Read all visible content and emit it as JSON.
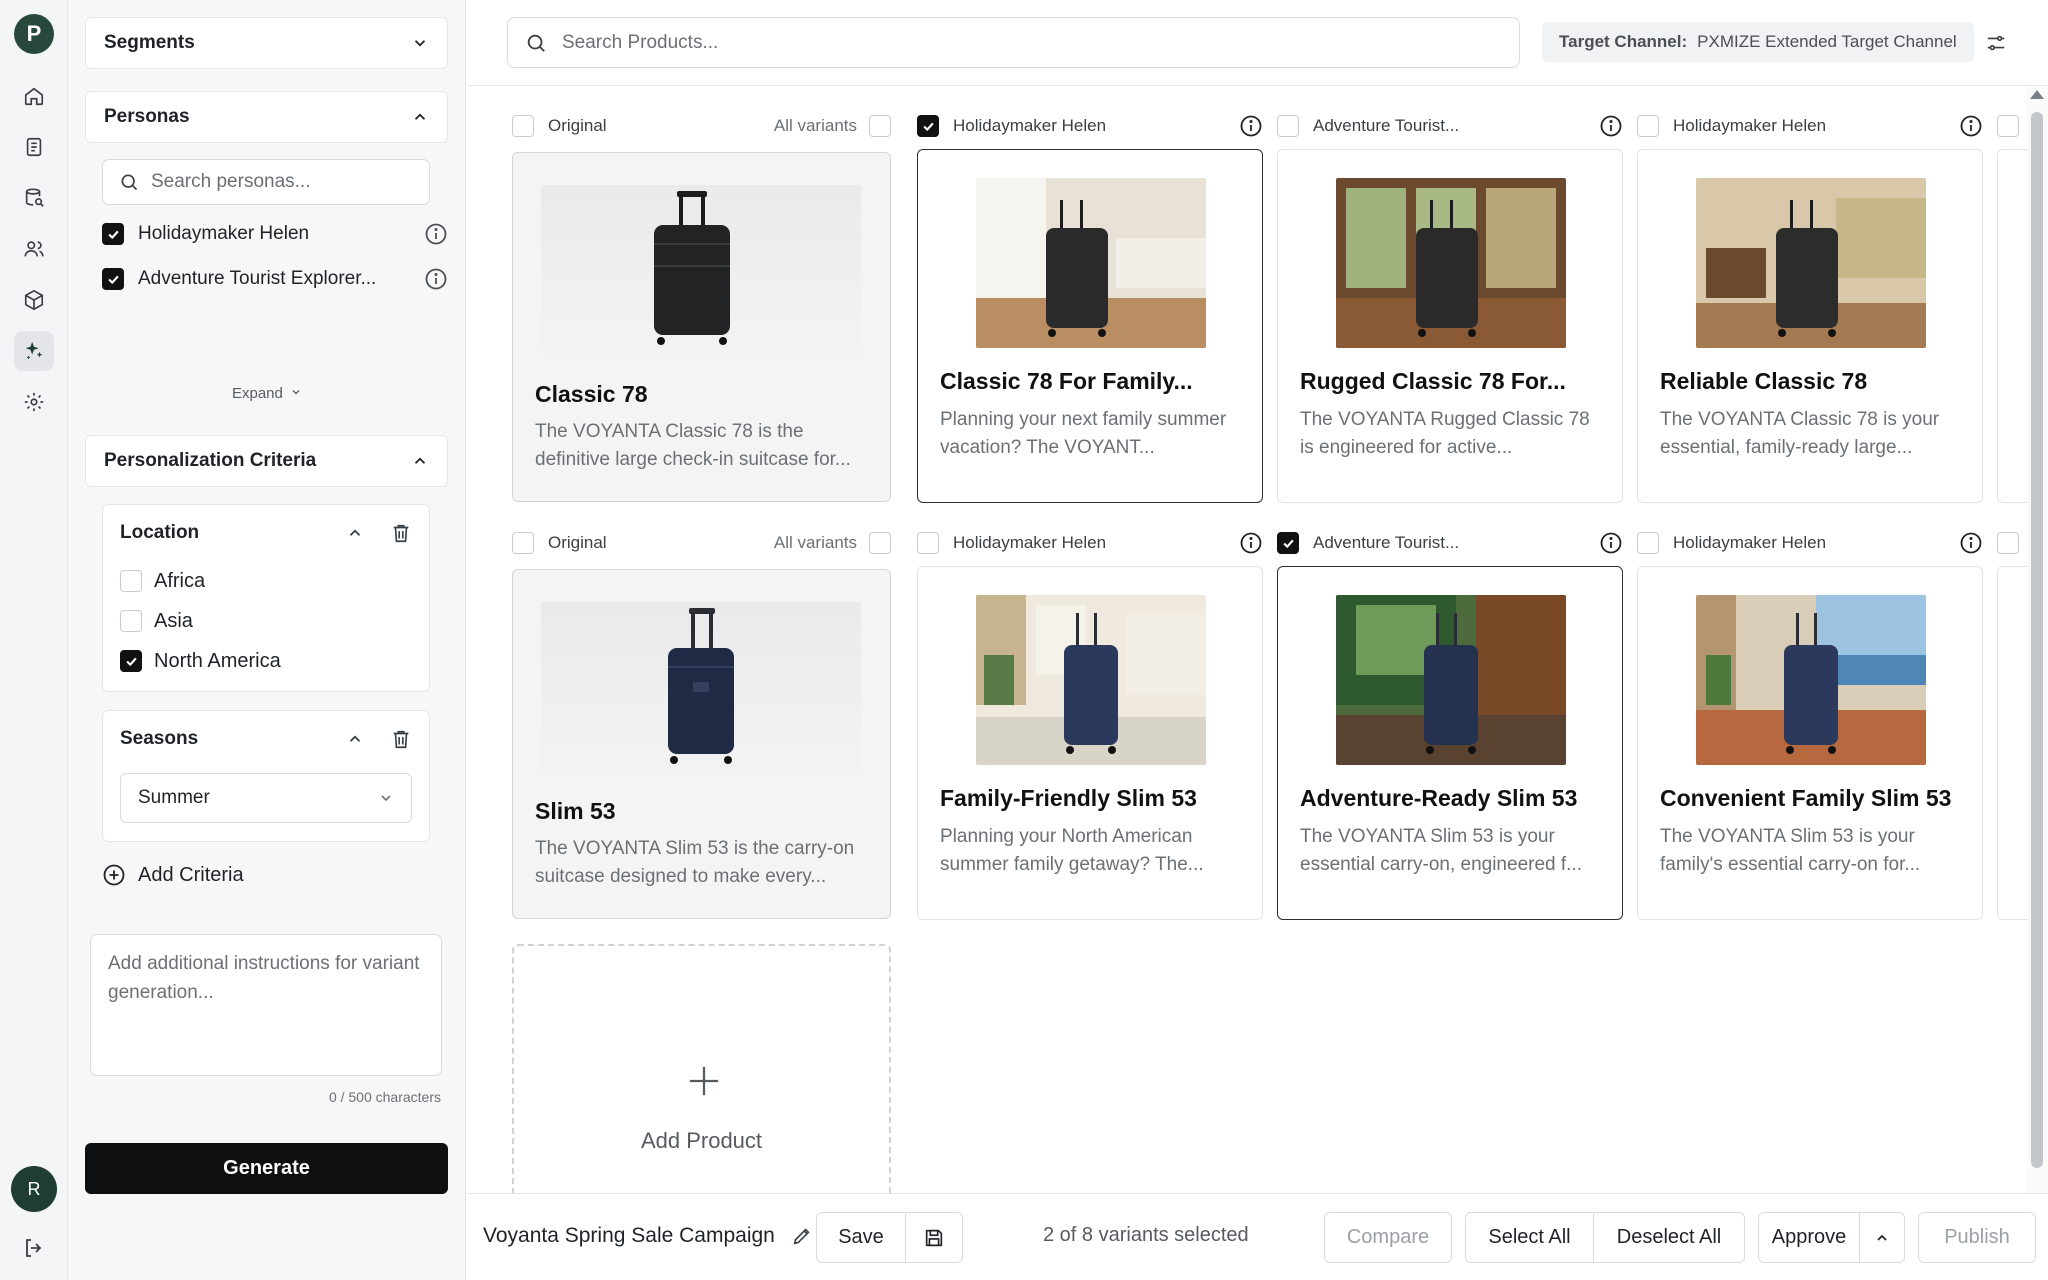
{
  "rail": {
    "logo_letter": "P",
    "avatar_letter": "R",
    "items": [
      "home-icon",
      "document-icon",
      "database-icon",
      "users-icon",
      "box-icon",
      "sparkle-icon",
      "gear-icon"
    ],
    "active_index": 5
  },
  "panel": {
    "segments_label": "Segments",
    "personas_label": "Personas",
    "persona_search_placeholder": "Search personas...",
    "personas": [
      {
        "label": "Holidaymaker Helen",
        "checked": true
      },
      {
        "label": "Adventure Tourist Explorer...",
        "checked": true
      }
    ],
    "expand_label": "Expand",
    "criteria_label": "Personalization Criteria",
    "location": {
      "label": "Location",
      "options": [
        {
          "label": "Africa",
          "checked": false
        },
        {
          "label": "Asia",
          "checked": false
        },
        {
          "label": "North America",
          "checked": true
        }
      ]
    },
    "seasons": {
      "label": "Seasons",
      "selected": "Summer"
    },
    "add_criteria_label": "Add Criteria",
    "instructions_placeholder": "Add additional instructions for variant generation...",
    "char_count": "0 / 500 characters",
    "generate_label": "Generate"
  },
  "topbar": {
    "search_placeholder": "Search Products...",
    "channel_label": "Target Channel:",
    "channel_value": "PXMIZE Extended Target Channel"
  },
  "grid": {
    "all_variants_label": "All variants",
    "rows": [
      {
        "columns": [
          {
            "header": "Original",
            "checked": false,
            "title": "Classic 78",
            "desc": "The VOYANTA Classic 78 is the definitive large check-in suitcase for..."
          },
          {
            "header": "Holidaymaker Helen",
            "checked": true,
            "title": "Classic 78 For Family...",
            "desc": "Planning your next family summer vacation? The VOYANT..."
          },
          {
            "header": "Adventure Tourist...",
            "checked": false,
            "title": "Rugged Classic 78 For...",
            "desc": "The VOYANTA Rugged Classic 78 is engineered for active..."
          },
          {
            "header": "Holidaymaker Helen",
            "checked": false,
            "title": "Reliable Classic 78",
            "desc": "The VOYANTA Classic 78 is your essential, family-ready large..."
          }
        ]
      },
      {
        "columns": [
          {
            "header": "Original",
            "checked": false,
            "title": "Slim 53",
            "desc": "The VOYANTA Slim 53 is the carry-on suitcase designed to make every..."
          },
          {
            "header": "Holidaymaker Helen",
            "checked": false,
            "title": "Family-Friendly Slim 53",
            "desc": "Planning your North American summer family getaway? The..."
          },
          {
            "header": "Adventure Tourist...",
            "checked": true,
            "title": "Adventure-Ready Slim 53",
            "desc": "The VOYANTA Slim 53 is your essential carry-on, engineered f..."
          },
          {
            "header": "Holidaymaker Helen",
            "checked": false,
            "title": "Convenient Family Slim 53",
            "desc": "The VOYANTA Slim 53 is your family's essential carry-on for..."
          }
        ]
      }
    ],
    "add_product_label": "Add Product"
  },
  "footer": {
    "campaign_name": "Voyanta Spring Sale Campaign",
    "save_label": "Save",
    "selection_status": "2 of 8 variants selected",
    "compare_label": "Compare",
    "select_all_label": "Select All",
    "deselect_all_label": "Deselect All",
    "approve_label": "Approve",
    "publish_label": "Publish"
  }
}
